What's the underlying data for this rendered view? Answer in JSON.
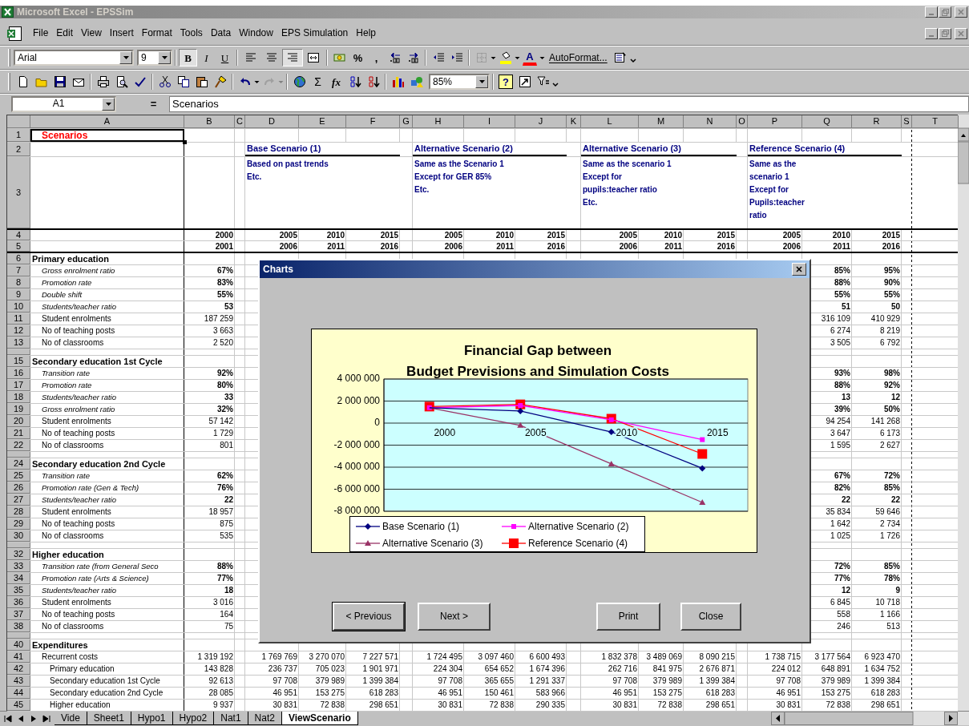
{
  "window": {
    "title": "Microsoft Excel - EPSSim"
  },
  "menu": [
    "File",
    "Edit",
    "View",
    "Insert",
    "Format",
    "Tools",
    "Data",
    "Window",
    "EPS Simulation",
    "Help"
  ],
  "formatting_toolbar": {
    "font": "Arial",
    "size": "9",
    "style_buttons": [
      {
        "label": "B",
        "pressed": true
      },
      {
        "label": "I",
        "pressed": false
      },
      {
        "label": "U",
        "pressed": false
      }
    ],
    "align_buttons": [
      {
        "kind": "left",
        "pressed": false
      },
      {
        "kind": "center",
        "pressed": false
      },
      {
        "kind": "right",
        "pressed": true
      },
      {
        "kind": "merge",
        "pressed": false
      }
    ],
    "number_buttons": [
      "%",
      ","
    ],
    "font_color_button": "A",
    "autoformat": "AutoFormat..."
  },
  "standard_toolbar": {
    "sum_button": "Σ",
    "function_button": "fx",
    "zoom": "85%",
    "help_button": "?"
  },
  "formula_bar": {
    "name_box": "A1",
    "equals": "=",
    "content": "Scenarios"
  },
  "columns": [
    "A",
    "B",
    "C",
    "D",
    "E",
    "F",
    "G",
    "H",
    "I",
    "J",
    "K",
    "L",
    "M",
    "N",
    "O",
    "P",
    "Q",
    "R",
    "S",
    "T"
  ],
  "rows": [
    {
      "num": "1",
      "kind": "title",
      "label": "Scenarios"
    },
    {
      "num": "2",
      "kind": "scenario_titles",
      "scenarios": [
        "Base Scenario (1)",
        "Alternative Scenario (2)",
        "Alternative Scenario (3)",
        "Reference Scenario (4)"
      ]
    },
    {
      "num": "3",
      "kind": "scenario_notes",
      "notes": [
        [
          "Based on past trends",
          "Etc."
        ],
        [
          "Same as the Scenario 1",
          "Except for GER 85%",
          "Etc."
        ],
        [
          "Same as the scenario 1",
          "Except for",
          "pupils:teacher ratio",
          "Etc."
        ],
        [
          "Same as the",
          "scenario 1",
          "Except for",
          "Pupils:teacher",
          "ratio"
        ]
      ]
    },
    {
      "num": "4",
      "kind": "years",
      "values": [
        "2000",
        "2005",
        "2010",
        "2015",
        "2005",
        "2010",
        "2015",
        "2005",
        "2010",
        "2015",
        "2005",
        "2010",
        "2015"
      ]
    },
    {
      "num": "5",
      "kind": "years",
      "values": [
        "2001",
        "2006",
        "2011",
        "2016",
        "2006",
        "2011",
        "2016",
        "2006",
        "2011",
        "2016",
        "2006",
        "2011",
        "2016"
      ]
    },
    {
      "num": "6",
      "kind": "section",
      "label": "Primary education"
    },
    {
      "num": "7",
      "kind": "param",
      "label": "Gross enrolment ratio",
      "values": [
        "67%",
        "85%",
        "95%"
      ]
    },
    {
      "num": "8",
      "kind": "param",
      "label": "Promotion rate",
      "values": [
        "83%",
        "88%",
        "90%"
      ]
    },
    {
      "num": "9",
      "kind": "param",
      "label": "Double shift",
      "values": [
        "55%",
        "55%",
        "55%"
      ]
    },
    {
      "num": "10",
      "kind": "param",
      "label": "Students/teacher ratio",
      "values": [
        "53",
        "51",
        "50"
      ]
    },
    {
      "num": "11",
      "kind": "count",
      "label": "Student enrolments",
      "values": [
        "187 259",
        "316 109",
        "410 929"
      ]
    },
    {
      "num": "12",
      "kind": "count",
      "label": "No of teaching posts",
      "values": [
        "3 663",
        "6 274",
        "8 219"
      ]
    },
    {
      "num": "13",
      "kind": "count",
      "label": "No of classrooms",
      "values": [
        "2 520",
        "3 505",
        "6 792"
      ]
    },
    {
      "kind": "blank"
    },
    {
      "num": "15",
      "kind": "section",
      "label": "Secondary education 1st Cycle"
    },
    {
      "num": "16",
      "kind": "param",
      "label": "Transition rate",
      "values": [
        "92%",
        "93%",
        "98%"
      ]
    },
    {
      "num": "17",
      "kind": "param",
      "label": "Promotion rate",
      "values": [
        "80%",
        "88%",
        "92%"
      ]
    },
    {
      "num": "18",
      "kind": "param",
      "label": "Students/teacher ratio",
      "values": [
        "33",
        "13",
        "12"
      ]
    },
    {
      "num": "19",
      "kind": "param",
      "label": "Gross enrolment ratio",
      "values": [
        "32%",
        "39%",
        "50%"
      ]
    },
    {
      "num": "20",
      "kind": "count",
      "label": "Student enrolments",
      "values": [
        "57 142",
        "94 254",
        "141 268"
      ]
    },
    {
      "num": "21",
      "kind": "count",
      "label": "No of teaching posts",
      "values": [
        "1 729",
        "3 647",
        "6 173"
      ]
    },
    {
      "num": "22",
      "kind": "count",
      "label": "No of classrooms",
      "values": [
        "801",
        "1 595",
        "2 627"
      ]
    },
    {
      "kind": "blank"
    },
    {
      "num": "24",
      "kind": "section",
      "label": "Secondary education 2nd Cycle"
    },
    {
      "num": "25",
      "kind": "param",
      "label": "Transition rate",
      "values": [
        "62%",
        "67%",
        "72%"
      ]
    },
    {
      "num": "26",
      "kind": "param",
      "label": "Promotion rate (Gen & Tech)",
      "values": [
        "76%",
        "82%",
        "85%"
      ]
    },
    {
      "num": "27",
      "kind": "param",
      "label": "Students/teacher ratio",
      "values": [
        "22",
        "22",
        "22"
      ]
    },
    {
      "num": "28",
      "kind": "count",
      "label": "Student enrolments",
      "values": [
        "18 957",
        "35 834",
        "59 646"
      ]
    },
    {
      "num": "29",
      "kind": "count",
      "label": "No of teaching posts",
      "values": [
        "875",
        "1 642",
        "2 734"
      ]
    },
    {
      "num": "30",
      "kind": "count",
      "label": "No of classrooms",
      "values": [
        "535",
        "1 025",
        "1 726"
      ]
    },
    {
      "kind": "blank"
    },
    {
      "num": "32",
      "kind": "section",
      "label": "Higher education"
    },
    {
      "num": "33",
      "kind": "param",
      "label": "Transition rate (from General Seco",
      "values": [
        "88%",
        "72%",
        "85%"
      ]
    },
    {
      "num": "34",
      "kind": "param",
      "label": "Promotion rate (Arts & Science)",
      "values": [
        "77%",
        "77%",
        "78%"
      ]
    },
    {
      "num": "35",
      "kind": "param",
      "label": "Students/teacher ratio",
      "values": [
        "18",
        "12",
        "9"
      ]
    },
    {
      "num": "36",
      "kind": "count",
      "label": "Student enrolments",
      "values": [
        "3 016",
        "6 845",
        "10 718"
      ]
    },
    {
      "num": "37",
      "kind": "count",
      "label": "No of teaching posts",
      "values": [
        "164",
        "558",
        "1 166"
      ]
    },
    {
      "num": "38",
      "kind": "count",
      "label": "No of classrooms",
      "values": [
        "75",
        "246",
        "513"
      ]
    },
    {
      "kind": "blank"
    },
    {
      "num": "40",
      "kind": "section",
      "label": "Expenditures"
    },
    {
      "num": "41",
      "kind": "cost",
      "label": "Recurrent costs",
      "values": [
        "1 319 192",
        "1 769 769",
        "3 270 070",
        "7 227 571",
        "1 724 495",
        "3 097 460",
        "6 600 493",
        "1 832 378",
        "3 489 069",
        "8 090 215",
        "1 738 715",
        "3 177 564",
        "6 923 470"
      ]
    },
    {
      "num": "42",
      "kind": "subcost",
      "label": "Primary education",
      "values": [
        "143 828",
        "236 737",
        "705 023",
        "1 901 971",
        "224 304",
        "654 652",
        "1 674 396",
        "262 716",
        "841 975",
        "2 676 871",
        "224 012",
        "648 891",
        "1 634 752"
      ]
    },
    {
      "num": "43",
      "kind": "subcost",
      "label": "Secondary education 1st Cycle",
      "values": [
        "92 613",
        "97 708",
        "379 989",
        "1 399 384",
        "97 708",
        "365 655",
        "1 291 337",
        "97 708",
        "379 989",
        "1 399 384",
        "97 708",
        "379 989",
        "1 399 384"
      ]
    },
    {
      "num": "44",
      "kind": "subcost",
      "label": "Secondary education 2nd Cycle",
      "values": [
        "28 085",
        "46 951",
        "153 275",
        "618 283",
        "46 951",
        "150 461",
        "583 966",
        "46 951",
        "153 275",
        "618 283",
        "46 951",
        "153 275",
        "618 283"
      ]
    },
    {
      "num": "45",
      "kind": "subcost",
      "label": "Higher education",
      "values": [
        "9 937",
        "30 831",
        "72 838",
        "298 651",
        "30 831",
        "72 838",
        "290 335",
        "30 831",
        "72 838",
        "298 651",
        "30 831",
        "72 838",
        "298 651"
      ]
    }
  ],
  "sheet_tabs": [
    {
      "label": "Vide",
      "selected": false
    },
    {
      "label": "Sheet1",
      "selected": false
    },
    {
      "label": "Hypo1",
      "selected": false
    },
    {
      "label": "Hypo2",
      "selected": false
    },
    {
      "label": "Nat1",
      "selected": false
    },
    {
      "label": "Nat2",
      "selected": false
    },
    {
      "label": "ViewScenario",
      "selected": true
    }
  ],
  "dialog": {
    "title": "Charts",
    "buttons": [
      {
        "label": "< Previous",
        "default": true
      },
      {
        "label": "Next >",
        "default": false
      },
      {
        "label": "Print",
        "default": false
      },
      {
        "label": "Close",
        "default": false
      }
    ],
    "chart_data": {
      "type": "line",
      "grid": true,
      "legend": true,
      "title": "Financial Gap between\nBudget Previsions and Simulation Costs",
      "categories": [
        "2000",
        "2005",
        "2010",
        "2015"
      ],
      "ylim": [
        -8000000,
        4000000
      ],
      "yticks": [
        {
          "value": 4000000,
          "label": "4 000 000"
        },
        {
          "value": 2000000,
          "label": "2 000 000"
        },
        {
          "value": 0,
          "label": "0"
        },
        {
          "value": -2000000,
          "label": "-2 000 000"
        },
        {
          "value": -4000000,
          "label": "-4 000 000"
        },
        {
          "value": -6000000,
          "label": "-6 000 000"
        },
        {
          "value": -8000000,
          "label": "-8 000 000"
        }
      ],
      "series": [
        {
          "name": "Base Scenario (1)",
          "color": "#000080",
          "marker": "diamond",
          "values": [
            1400000,
            1100000,
            -800000,
            -4100000
          ]
        },
        {
          "name": "Alternative Scenario (2)",
          "color": "#ff00ff",
          "marker": "square",
          "values": [
            1400000,
            1600000,
            300000,
            -1500000
          ]
        },
        {
          "name": "Alternative Scenario (3)",
          "color": "#993366",
          "marker": "triangle",
          "values": [
            1400000,
            -200000,
            -3700000,
            -7200000
          ]
        },
        {
          "name": "Reference Scenario (4)",
          "color": "#ff0000",
          "marker": "square-large",
          "values": [
            1500000,
            1700000,
            400000,
            -2800000
          ]
        }
      ]
    }
  }
}
